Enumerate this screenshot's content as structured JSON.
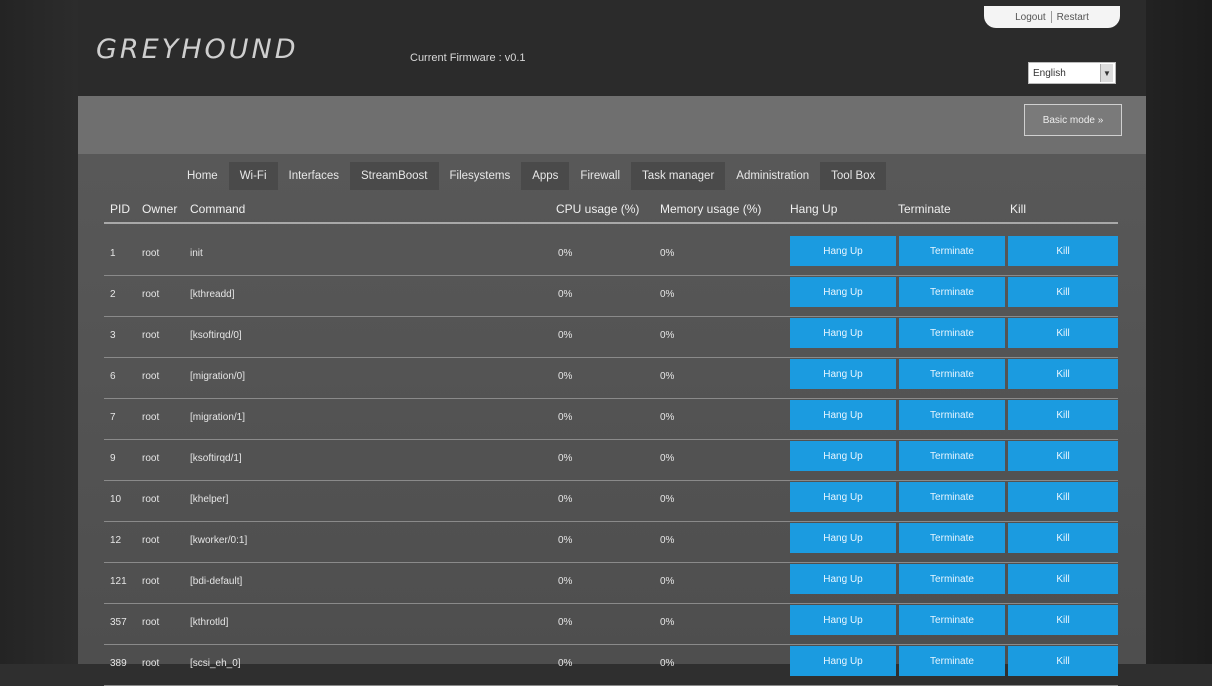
{
  "header": {
    "logo": "GREYHOUND",
    "firmware": "Current Firmware : v0.1",
    "logout": "Logout",
    "restart": "Restart",
    "language": "English"
  },
  "mode_button": "Basic mode »",
  "nav": {
    "tabs": [
      {
        "label": "Home"
      },
      {
        "label": "Wi-Fi"
      },
      {
        "label": "Interfaces"
      },
      {
        "label": "StreamBoost"
      },
      {
        "label": "Filesystems"
      },
      {
        "label": "Apps"
      },
      {
        "label": "Firewall"
      },
      {
        "label": "Task manager"
      },
      {
        "label": "Administration"
      },
      {
        "label": "Tool Box"
      }
    ]
  },
  "table": {
    "headers": {
      "pid": "PID",
      "owner": "Owner",
      "command": "Command",
      "cpu": "CPU usage (%)",
      "memory": "Memory usage (%)",
      "hangup": "Hang Up",
      "terminate": "Terminate",
      "kill": "Kill"
    },
    "action_labels": {
      "hangup": "Hang Up",
      "terminate": "Terminate",
      "kill": "Kill"
    },
    "rows": [
      {
        "pid": "1",
        "owner": "root",
        "command": "init",
        "cpu": "0%",
        "memory": "0%"
      },
      {
        "pid": "2",
        "owner": "root",
        "command": "[kthreadd]",
        "cpu": "0%",
        "memory": "0%"
      },
      {
        "pid": "3",
        "owner": "root",
        "command": "[ksoftirqd/0]",
        "cpu": "0%",
        "memory": "0%"
      },
      {
        "pid": "6",
        "owner": "root",
        "command": "[migration/0]",
        "cpu": "0%",
        "memory": "0%"
      },
      {
        "pid": "7",
        "owner": "root",
        "command": "[migration/1]",
        "cpu": "0%",
        "memory": "0%"
      },
      {
        "pid": "9",
        "owner": "root",
        "command": "[ksoftirqd/1]",
        "cpu": "0%",
        "memory": "0%"
      },
      {
        "pid": "10",
        "owner": "root",
        "command": "[khelper]",
        "cpu": "0%",
        "memory": "0%"
      },
      {
        "pid": "12",
        "owner": "root",
        "command": "[kworker/0:1]",
        "cpu": "0%",
        "memory": "0%"
      },
      {
        "pid": "121",
        "owner": "root",
        "command": "[bdi-default]",
        "cpu": "0%",
        "memory": "0%"
      },
      {
        "pid": "357",
        "owner": "root",
        "command": "[kthrotld]",
        "cpu": "0%",
        "memory": "0%"
      },
      {
        "pid": "389",
        "owner": "root",
        "command": "[scsi_eh_0]",
        "cpu": "0%",
        "memory": "0%"
      }
    ]
  }
}
